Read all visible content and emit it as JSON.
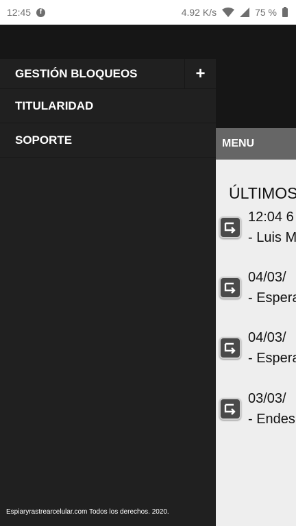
{
  "status_bar": {
    "time": "12:45",
    "net_speed": "4.92 K/s",
    "battery": "75 %"
  },
  "drawer": {
    "items": [
      {
        "label": "GESTIÓN BLOQUEOS",
        "expand": "+"
      },
      {
        "label": "TITULARIDAD"
      },
      {
        "label": "SOPORTE"
      }
    ],
    "footer": "Espiaryrastrearcelular.com Todos los derechos. 2020."
  },
  "page": {
    "menu_label": "MENU",
    "title": "ÚLTIMOS",
    "entries": [
      {
        "line1": "12:04 6",
        "line2": "- Luis M"
      },
      {
        "line1": "04/03/",
        "line2": "- Espera"
      },
      {
        "line1": "04/03/",
        "line2": "- Espera"
      },
      {
        "line1": "03/03/",
        "line2": "- Endes"
      }
    ]
  },
  "icons": {
    "status": [
      "facebook-icon",
      "wifi-icon",
      "signal-icon",
      "battery-icon"
    ],
    "entry": "redirect-arrow-icon"
  }
}
